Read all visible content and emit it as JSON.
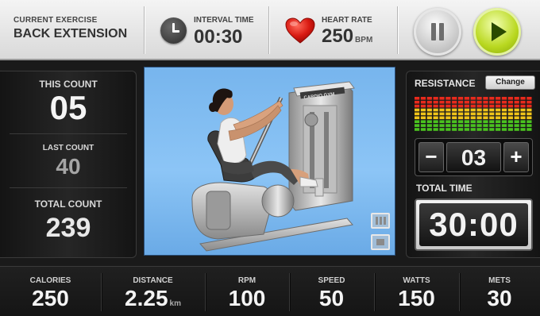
{
  "header": {
    "exercise_label": "CURRENT EXERCISE",
    "exercise_name": "BACK EXTENSION",
    "interval_label": "INTERVAL TIME",
    "interval_value": "00:30",
    "heart_label": "HEART RATE",
    "heart_value": "250",
    "heart_unit": "BPM",
    "pause_icon": "pause-icon",
    "play_icon": "play-icon",
    "play_color": "#b9d820"
  },
  "counts": {
    "this_label": "THIS COUNT",
    "this_value": "05",
    "last_label": "LAST COUNT",
    "last_value": "40",
    "total_label": "TOTAL COUNT",
    "total_value": "239"
  },
  "image": {
    "machine_brand": "CARDIO GYM",
    "icons": [
      "list-icon",
      "screen-icon"
    ]
  },
  "resistance": {
    "label": "RESISTANCE",
    "change_label": "Change",
    "minus_label": "−",
    "plus_label": "+",
    "value": "03",
    "level_colors": [
      "#e82a1c",
      "#f0c419",
      "#4ac21f"
    ]
  },
  "total_time": {
    "label": "TOTAL TIME",
    "value": "30:00"
  },
  "stats": [
    {
      "label": "CALORIES",
      "value": "250",
      "unit": ""
    },
    {
      "label": "DISTANCE",
      "value": "2.25",
      "unit": "km"
    },
    {
      "label": "RPM",
      "value": "100",
      "unit": ""
    },
    {
      "label": "SPEED",
      "value": "50",
      "unit": ""
    },
    {
      "label": "WATTS",
      "value": "150",
      "unit": ""
    },
    {
      "label": "METS",
      "value": "30",
      "unit": ""
    }
  ]
}
